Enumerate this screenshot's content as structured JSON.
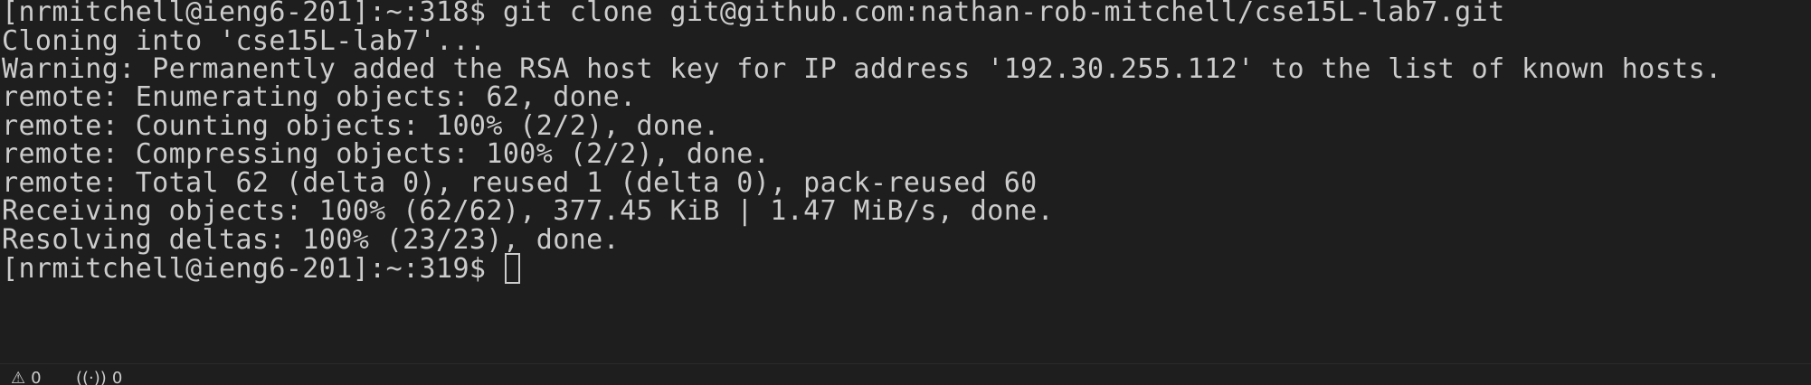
{
  "terminal": {
    "lines": [
      "[nrmitchell@ieng6-201]:~:318$ git clone git@github.com:nathan-rob-mitchell/cse15L-lab7.git",
      "Cloning into 'cse15L-lab7'...",
      "Warning: Permanently added the RSA host key for IP address '192.30.255.112' to the list of known hosts.",
      "remote: Enumerating objects: 62, done.",
      "remote: Counting objects: 100% (2/2), done.",
      "remote: Compressing objects: 100% (2/2), done.",
      "remote: Total 62 (delta 0), reused 1 (delta 0), pack-reused 60",
      "Receiving objects: 100% (62/62), 377.45 KiB | 1.47 MiB/s, done.",
      "Resolving deltas: 100% (23/23), done."
    ],
    "prompt": "[nrmitchell@ieng6-201]:~:319$ "
  },
  "statusbar": {
    "warnings_icon": "warning-icon",
    "warnings_count": "0",
    "ports_icon": "broadcast-icon",
    "ports_count": "0"
  },
  "colors": {
    "background": "#1e1e1e",
    "foreground": "#cccccc"
  }
}
